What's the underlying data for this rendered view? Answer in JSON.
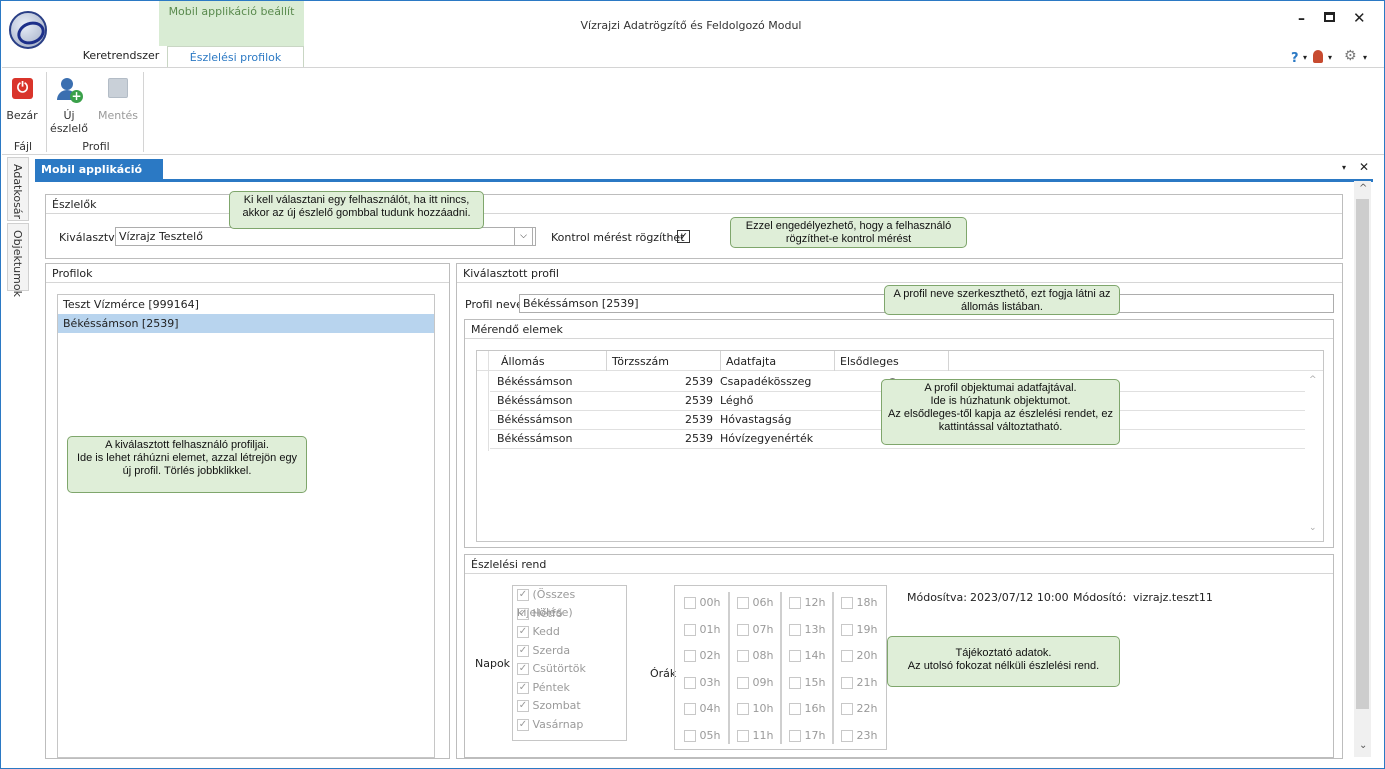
{
  "window": {
    "title": "Vízrajzi Adatrögzítő és Feldolgozó Modul",
    "context_tab": "Mobil applikáció beállít"
  },
  "ribbon": {
    "tabs": [
      "Keretrendszer",
      "Észlelési profilok"
    ],
    "buttons": {
      "close": "Bezár",
      "new_observer_1": "Új",
      "new_observer_2": "észlelő",
      "save": "Mentés"
    },
    "groups": {
      "file": "Fájl",
      "profile": "Profil"
    }
  },
  "side_tabs": [
    "Adatkosár",
    "Objektumok"
  ],
  "document_tab": "Mobil applikáció beállít",
  "observers": {
    "header": "Észlelők",
    "select_label": "Kiválasztva",
    "selected": "Vízrajz Tesztelő",
    "control_label": "Kontrol mérést rögzíthet",
    "control_checked": true
  },
  "profiles": {
    "header": "Profilok",
    "items": [
      "Teszt Vízmérce [999164]",
      "Békéssámson [2539]"
    ],
    "selected_index": 1
  },
  "selected_profile": {
    "header": "Kiválasztott profil",
    "name_label": "Profil neve",
    "name_value": "Békéssámson [2539]"
  },
  "measured": {
    "header": "Mérendő elemek",
    "columns": [
      "Állomás",
      "Törzsszám",
      "Adatfajta",
      "Elsődleges"
    ],
    "rows": [
      [
        "Békéssámson",
        "2539",
        "Csapadékösszeg"
      ],
      [
        "Békéssámson",
        "2539",
        "Léghő"
      ],
      [
        "Békéssámson",
        "2539",
        "Hóvastagság"
      ],
      [
        "Békéssámson",
        "2539",
        "Hóvízegyenérték"
      ]
    ]
  },
  "schedule": {
    "header": "Észlelési rend",
    "days_label": "Napok",
    "hours_label": "Órák",
    "days": [
      "(Összes kijelölése)",
      "Hétfő",
      "Kedd",
      "Szerda",
      "Csütörtök",
      "Péntek",
      "Szombat",
      "Vasárnap"
    ],
    "hours": [
      "00h",
      "01h",
      "02h",
      "03h",
      "04h",
      "05h",
      "06h",
      "07h",
      "08h",
      "09h",
      "10h",
      "11h",
      "12h",
      "13h",
      "14h",
      "15h",
      "16h",
      "17h",
      "18h",
      "19h",
      "20h",
      "21h",
      "22h",
      "23h"
    ],
    "modified_label": "Módosítva:",
    "modified_value": "2023/07/12 10:00",
    "modifier_label": "Módosító:",
    "modifier_value": "vizrajz.teszt11"
  },
  "notes": {
    "n1": [
      "Ki kell választani egy felhasználót, ha itt nincs,",
      "akkor az új észlelő gombbal tudunk hozzáadni."
    ],
    "n2": [
      "Ezzel engedélyezhető, hogy a felhasználó",
      "rögzíthet-e kontrol mérést"
    ],
    "n3": [
      "A profil neve szerkeszthető, ezt fogja látni az",
      "állomás listában."
    ],
    "n4": [
      "A profil objektumai adatfajtával.",
      "Ide is húzhatunk objektumot.",
      "Az elsődleges-től kapja az észlelési rendet, ez",
      "kattintással változtatható."
    ],
    "n5": [
      "A kiválasztott felhasználó profiljai.",
      "Ide is lehet ráhúzni elemet, azzal létrejön egy",
      "új profil. Törlés jobbklikkel."
    ],
    "n6": [
      "Tájékoztató adatok.",
      "Az utolsó fokozat nélküli észlelési rend."
    ]
  },
  "colors": {
    "accent": "#2b79c4",
    "context_green": "#d9ecd4",
    "note_bg": "#dfeed8",
    "selection": "#b8d4ee"
  }
}
